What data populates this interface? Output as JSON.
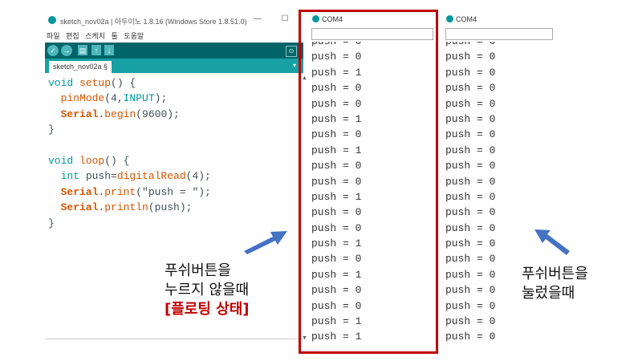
{
  "ide": {
    "title": "sketch_nov02a | 아두이노 1.8.16 (Windows Store 1.8.51.0)",
    "window_controls": [
      "—",
      "☐"
    ],
    "menu": [
      "파일",
      "편집",
      "스케치",
      "툴",
      "도움말"
    ],
    "toolbar": {
      "verify": "✓",
      "upload": "→",
      "new": "▤",
      "open": "↑",
      "save": "↓",
      "serial_monitor": "⊙"
    },
    "tab_label": "sketch_nov02a §",
    "tab_menu": "▾",
    "code": [
      "void setup() {",
      "  pinMode(4,INPUT);",
      "  Serial.begin(9600);",
      "}",
      "",
      "void loop() {",
      "  int push=digitalRead(4);",
      "  Serial.print(\"push = \");",
      "  Serial.println(push);",
      "}"
    ],
    "scroll_up": "▲",
    "scroll_down": "▼"
  },
  "serial_floating": {
    "title": "COM4",
    "lines": [
      "push = 0",
      "push = 0",
      "push = 1",
      "push = 0",
      "push = 0",
      "push = 1",
      "push = 0",
      "push = 1",
      "push = 0",
      "push = 0",
      "push = 1",
      "push = 0",
      "push = 0",
      "push = 1",
      "push = 0",
      "push = 1",
      "push = 0",
      "push = 0",
      "push = 1",
      "push = 1"
    ]
  },
  "serial_pressed": {
    "title": "COM4",
    "lines": [
      "push = 0",
      "push = 0",
      "push = 0",
      "push = 0",
      "push = 0",
      "push = 0",
      "push = 0",
      "push = 0",
      "push = 0",
      "push = 0",
      "push = 0",
      "push = 0",
      "push = 0",
      "push = 0",
      "push = 0",
      "push = 0",
      "push = 0",
      "push = 0",
      "push = 0",
      "push = 0"
    ]
  },
  "captions": {
    "left_line1": "푸쉬버튼을",
    "left_line2": "누르지 않을때",
    "left_line3": "[플로팅 상태]",
    "right_line1": "푸쉬버튼을",
    "right_line2": "눌렀을때"
  },
  "colors": {
    "highlight": "#c00000",
    "arrow": "#4472c4",
    "ide_toolbar": "#006468",
    "ide_tabbar": "#17a1a5"
  }
}
